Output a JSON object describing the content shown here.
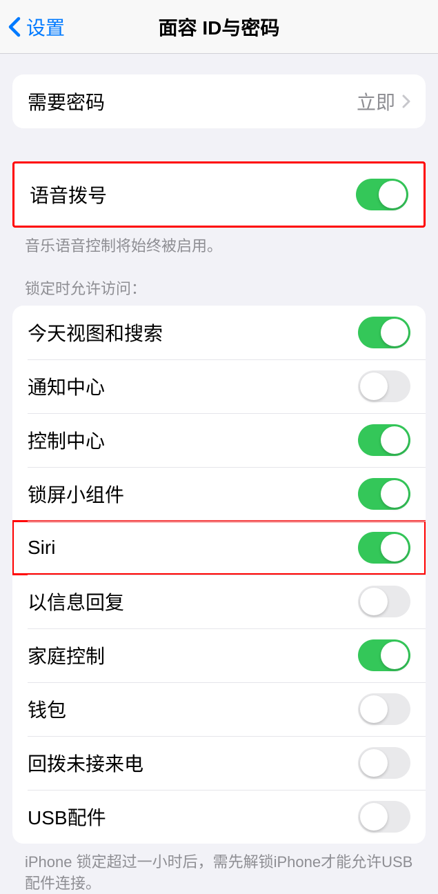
{
  "nav": {
    "back": "设置",
    "title": "面容 ID与密码"
  },
  "passcode_row": {
    "label": "需要密码",
    "value": "立即"
  },
  "voice_dial": {
    "label": "语音拨号",
    "on": true,
    "footer": "音乐语音控制将始终被启用。"
  },
  "locked_header": "锁定时允许访问：",
  "locked_items": [
    {
      "label": "今天视图和搜索",
      "on": true,
      "highlighted": false
    },
    {
      "label": "通知中心",
      "on": false,
      "highlighted": false
    },
    {
      "label": "控制中心",
      "on": true,
      "highlighted": false
    },
    {
      "label": "锁屏小组件",
      "on": true,
      "highlighted": false
    },
    {
      "label": "Siri",
      "on": true,
      "highlighted": true
    },
    {
      "label": "以信息回复",
      "on": false,
      "highlighted": false
    },
    {
      "label": "家庭控制",
      "on": true,
      "highlighted": false
    },
    {
      "label": "钱包",
      "on": false,
      "highlighted": false
    },
    {
      "label": "回拨未接来电",
      "on": false,
      "highlighted": false
    },
    {
      "label": "USB配件",
      "on": false,
      "highlighted": false
    }
  ],
  "usb_footer": "iPhone 锁定超过一小时后，需先解锁iPhone才能允许USB 配件连接。"
}
